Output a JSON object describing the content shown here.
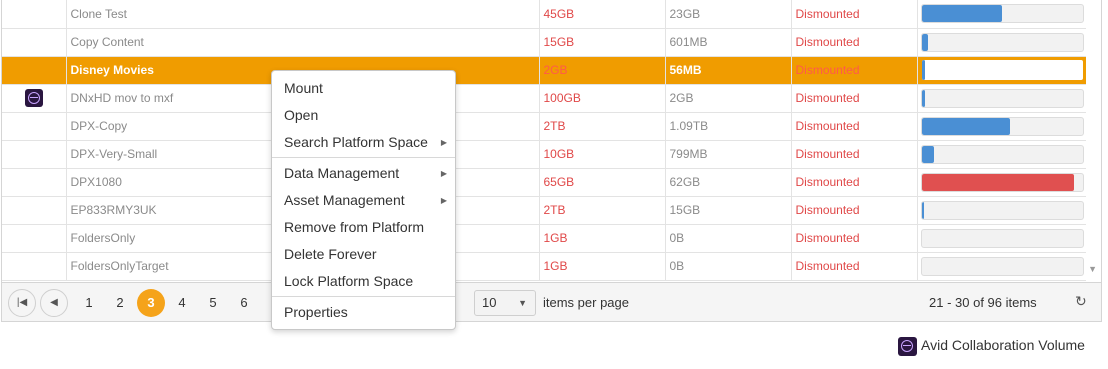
{
  "rows": [
    {
      "name": "Clone Test",
      "icon": "",
      "size": "45GB",
      "used": "23GB",
      "status": "Dismounted",
      "fill": 0.5,
      "color": "#4a8fd4"
    },
    {
      "name": "Copy Content",
      "icon": "",
      "size": "15GB",
      "used": "601MB",
      "status": "Dismounted",
      "fill": 0.04,
      "color": "#4a8fd4"
    },
    {
      "name": "Disney Movies",
      "icon": "",
      "size": "2GB",
      "used": "56MB",
      "status": "Dismounted",
      "fill": 0.02,
      "color": "#4a8fd4",
      "selected": true
    },
    {
      "name": "DNxHD mov to mxf",
      "icon": "avid-icon",
      "size": "100GB",
      "used": "2GB",
      "status": "Dismounted",
      "fill": 0.02,
      "color": "#4a8fd4"
    },
    {
      "name": "DPX-Copy",
      "icon": "",
      "size": "2TB",
      "used": "1.09TB",
      "status": "Dismounted",
      "fill": 0.55,
      "color": "#4a8fd4"
    },
    {
      "name": "DPX-Very-Small",
      "icon": "",
      "size": "10GB",
      "used": "799MB",
      "status": "Dismounted",
      "fill": 0.08,
      "color": "#4a8fd4"
    },
    {
      "name": "DPX1080",
      "icon": "",
      "size": "65GB",
      "used": "62GB",
      "status": "Dismounted",
      "fill": 0.95,
      "color": "#e05050"
    },
    {
      "name": "EP833RMY3UK",
      "icon": "",
      "size": "2TB",
      "used": "15GB",
      "status": "Dismounted",
      "fill": 0.01,
      "color": "#4a8fd4"
    },
    {
      "name": "FoldersOnly",
      "icon": "",
      "size": "1GB",
      "used": "0B",
      "status": "Dismounted",
      "fill": 0,
      "color": "#4a8fd4"
    },
    {
      "name": "FoldersOnlyTarget",
      "icon": "",
      "size": "1GB",
      "used": "0B",
      "status": "Dismounted",
      "fill": 0,
      "color": "#4a8fd4"
    }
  ],
  "pager": {
    "first_icon": "first-page-icon",
    "prev_icon": "prev-page-icon",
    "pages": [
      "1",
      "2",
      "3",
      "4",
      "5",
      "6"
    ],
    "current": "3",
    "page_size": "10",
    "per_page_label": "items per page",
    "info": "21 - 30 of 96 items",
    "refresh_icon": "refresh-icon"
  },
  "context_menu": {
    "groups": [
      [
        {
          "label": "Mount"
        },
        {
          "label": "Open"
        },
        {
          "label": "Search Platform Space",
          "submenu": true
        }
      ],
      [
        {
          "label": "Data Management",
          "submenu": true
        },
        {
          "label": "Asset Management",
          "submenu": true
        },
        {
          "label": "Remove from Platform"
        },
        {
          "label": "Delete Forever"
        },
        {
          "label": "Lock Platform Space"
        }
      ],
      [
        {
          "label": "Properties"
        }
      ]
    ]
  },
  "footer": {
    "label": "Avid Collaboration Volume",
    "icon": "avid-icon"
  },
  "colors": {
    "accent": "#f09c00",
    "bar": "#4a8fd4",
    "danger": "#e05050"
  }
}
